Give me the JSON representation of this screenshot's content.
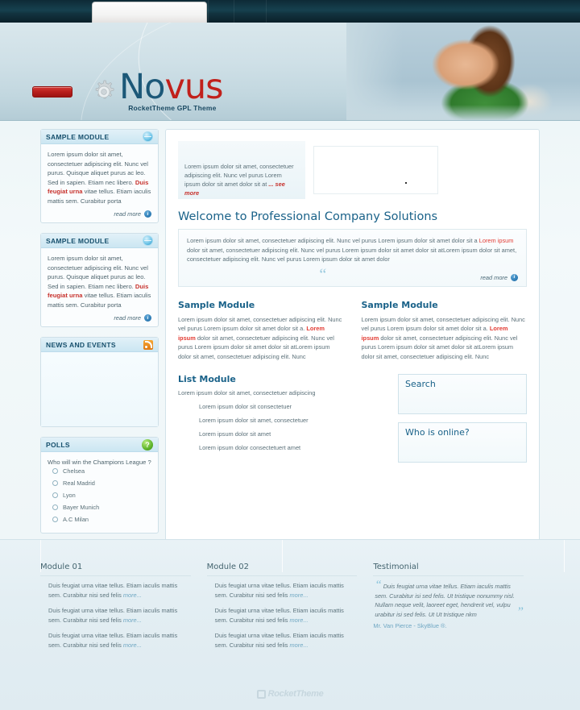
{
  "brand": {
    "name_part1": "No",
    "name_part2": "vus",
    "tagline": "RocketTheme GPL Theme",
    "accent_blue": "#1c5878",
    "accent_red": "#c1201b"
  },
  "sidebar": {
    "modules": [
      {
        "title": "SAMPLE MODULE",
        "icon": "globe-icon",
        "body_pre": "Lorem ipsum dolor sit amet, consectetuer adipiscing elit. Nunc vel purus. Quisque aliquet purus ac leo. Sed in sapien. Etiam nec libero. ",
        "body_highlight": "Duis feugiat urna",
        "body_post": " vitae tellus. Etiam iaculis mattis sem. Curabitur porta",
        "readmore": "read more"
      },
      {
        "title": "SAMPLE MODULE",
        "icon": "globe-icon",
        "body_pre": "Lorem ipsum dolor sit amet, consectetuer adipiscing elit. Nunc vel purus. Quisque aliquet purus ac leo. Sed in sapien. Etiam nec libero. ",
        "body_highlight": "Duis feugiat urna",
        "body_post": " vitae tellus. Etiam iaculis mattis sem. Curabitur porta",
        "readmore": "read more"
      }
    ],
    "news": {
      "title": "NEWS AND EVENTS",
      "icon": "rss-icon"
    },
    "polls": {
      "title": "POLLS",
      "icon": "help-icon",
      "question": "Who will win the Champions League ?",
      "options": [
        "Chelsea",
        "Real Madrid",
        "Lyon",
        "Bayer Munich",
        "A.C Milan"
      ]
    }
  },
  "main": {
    "newsflash": {
      "text": "Lorem ipsum dolor sit amet, consectetuer adipiscing elit. Nunc vel purus Lorem ipsum dolor sit amet dolor sit at",
      "more": "... see more"
    },
    "welcome": {
      "title": "Welcome to Professional Company Solutions",
      "para_pre": "Lorem ipsum dolor sit amet, consectetuer adipiscing elit. Nunc vel purus Lorem ipsum dolor sit amet dolor sit a ",
      "para_highlight": "Lorem ipsum",
      "para_post": " dolor sit amet, consectetuer adipiscing elit. Nunc vel purus Lorem ipsum dolor sit amet dolor sit atLorem ipsum dolor sit amet, consectetuer adipiscing elit. Nunc vel purus Lorem ipsum dolor sit amet dolor",
      "readmore": "read more"
    },
    "columns": [
      {
        "title": "Sample Module",
        "pre": "Lorem ipsum dolor sit amet, consectetuer adipiscing elit. Nunc vel purus Lorem ipsum dolor sit amet dolor sit a. ",
        "highlight": "Lorem ipsum",
        "post": " dolor sit amet, consectetuer adipiscing elit. Nunc vel purus Lorem ipsum dolor sit amet dolor sit atLorem ipsum dolor sit amet, consectetuer adipiscing elit. Nunc"
      },
      {
        "title": "Sample Module",
        "pre": "Lorem ipsum dolor sit amet, consectetuer adipiscing elit. Nunc vel purus Lorem ipsum dolor sit amet dolor sit a. ",
        "highlight": "Lorem ipsum",
        "post": " dolor sit amet, consectetuer adipiscing elit. Nunc vel purus Lorem ipsum dolor sit amet dolor sit atLorem ipsum dolor sit amet, consectetuer adipiscing elit. Nunc"
      }
    ],
    "list_module": {
      "title": "List Module",
      "intro": "Lorem ipsum dolor sit amet, consectetuer adipiscing",
      "items": [
        "Lorem ipsum dolor sit consectetuer",
        "Lorem ipsum dolor sit amet, consectetuer",
        "Lorem ipsum dolor sit amet",
        "Lorem ipsum dolor consectetuert amet"
      ]
    },
    "panels": [
      {
        "title": "Search"
      },
      {
        "title": "Who is online?"
      }
    ]
  },
  "footer": {
    "columns": [
      {
        "title": "Module 01",
        "items": [
          {
            "text": "Duis feugiat urna vitae tellus. Etiam iaculis mattis sem. Curabitur nisi sed felis ",
            "more": "more..."
          },
          {
            "text": "Duis feugiat urna vitae tellus. Etiam iaculis mattis sem. Curabitur nisi sed felis ",
            "more": "more..."
          },
          {
            "text": "Duis feugiat urna vitae tellus. Etiam iaculis mattis sem. Curabitur nisi sed felis ",
            "more": "more..."
          }
        ]
      },
      {
        "title": "Module 02",
        "items": [
          {
            "text": "Duis feugiat urna vitae tellus. Etiam iaculis mattis sem. Curabitur nisi sed felis ",
            "more": "more..."
          },
          {
            "text": "Duis feugiat urna vitae tellus. Etiam iaculis mattis sem. Curabitur nisi sed felis ",
            "more": "more..."
          },
          {
            "text": "Duis feugiat urna vitae tellus. Etiam iaculis mattis sem. Curabitur nisi sed felis ",
            "more": "more..."
          }
        ]
      }
    ],
    "testimonial": {
      "title": "Testimonial",
      "quote": "Duis feugiat urna vitae tellus. Etiam iaculis mattis sem. Curabitur  isi sed felis. Ut tristique nonummy nisl. Nullam neque velit, laoreet eget, hendrerit vel, vulpu urabitur  isi sed felis. Ut  Ut tristique nkm",
      "author": "Mr. Van Pierce - SkyBlue ®."
    },
    "rocket_logo": "RocketTheme"
  }
}
